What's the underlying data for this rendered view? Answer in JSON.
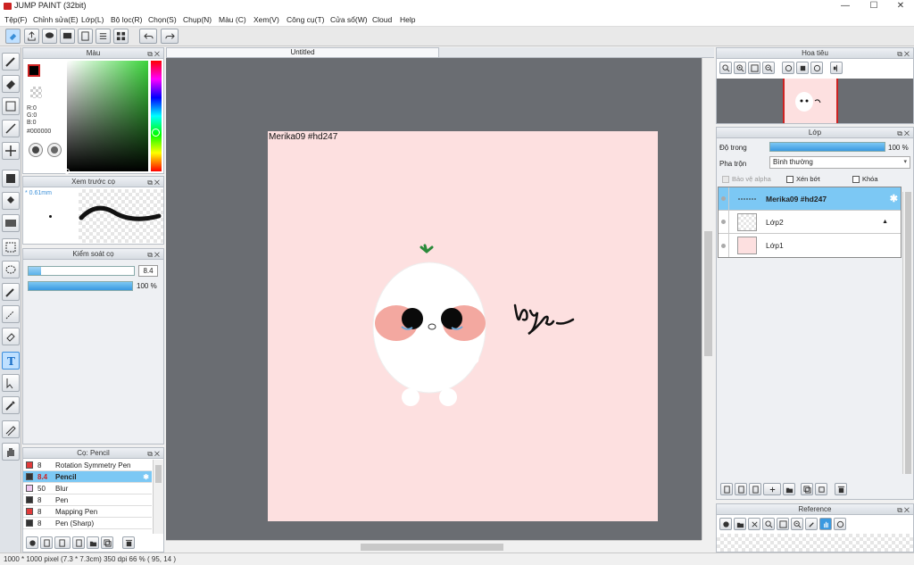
{
  "window": {
    "title": "JUMP PAINT (32bit)",
    "controls": [
      "—",
      "☐",
      "✕"
    ]
  },
  "menu": [
    "Tệp(F)",
    "Chỉnh sửa(E)",
    "Lớp(L)",
    "Bộ lọc(R)",
    "Chọn(S)",
    "Chụp(N)",
    "Màu (C)",
    "Xem(V)",
    "Công cụ(T)",
    "Cửa sổ(W)",
    "Cloud",
    "Help"
  ],
  "color_panel": {
    "title": "Màu",
    "r": "R:0",
    "g": "G:0",
    "b": "B:0",
    "hex": "#000000",
    "current_color": "#000000",
    "secondary_color": "#ffffff"
  },
  "brush_preview": {
    "title": "Xem trước cọ",
    "size_label": "* 0.61mm"
  },
  "brush_control": {
    "title": "Kiểm soát cọ",
    "size_value": "8.4",
    "size_fraction": 0.12,
    "opacity_value": "100 %",
    "opacity_fraction": 1.0
  },
  "brush_list": {
    "title": "Cọ: Pencil",
    "items": [
      {
        "size": "8",
        "name": "Rotation Symmetry Pen",
        "color": "#e23a3a",
        "selected": false
      },
      {
        "size": "8.4",
        "name": "Pencil",
        "color": "#333333",
        "selected": true
      },
      {
        "size": "50",
        "name": "Blur",
        "color": "#f0c8f0",
        "selected": false
      },
      {
        "size": "8",
        "name": "Pen",
        "color": "#333333",
        "selected": false
      },
      {
        "size": "8",
        "name": "Mapping Pen",
        "color": "#e23a3a",
        "selected": false
      },
      {
        "size": "8",
        "name": "Pen (Sharp)",
        "color": "#333333",
        "selected": false
      }
    ]
  },
  "canvas": {
    "tab_title": "Untitled",
    "signature_text": "Merika09  #hd247",
    "background": "#fde0e0",
    "handwriting": "bye"
  },
  "navigator": {
    "title": "Hoa tiêu"
  },
  "layers_panel": {
    "title": "Lớp",
    "opacity_label": "Độ trong",
    "opacity_value": "100 %",
    "opacity_fraction": 1.0,
    "blend_label": "Pha trộn",
    "blend_value": "Bình thường",
    "protect_alpha": "Bảo vệ alpha",
    "clipping": "Xén bớt",
    "lock": "Khóa",
    "layers": [
      {
        "name": "Merika09  #hd247",
        "selected": true
      },
      {
        "name": "Lớp2",
        "selected": false
      },
      {
        "name": "Lớp1",
        "selected": false
      }
    ]
  },
  "reference": {
    "title": "Reference"
  },
  "status": {
    "text": "1000 * 1000 pixel   (7.3 * 7.3cm)   350 dpi   66 %   ( 95, 14 )"
  },
  "colors": {
    "accent": "#7cc8f4",
    "canvas_bg": "#6a6d72",
    "slider_fill": "#4aa8e8"
  }
}
